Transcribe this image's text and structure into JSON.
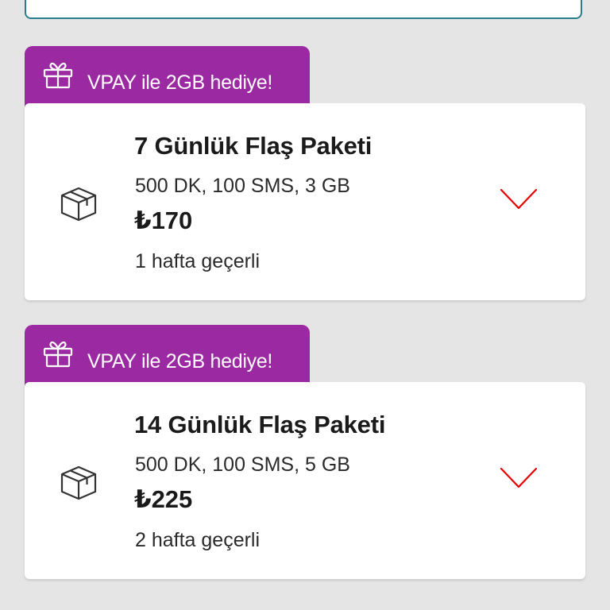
{
  "packages": [
    {
      "promo": "VPAY ile 2GB hediye!",
      "title": "7 Günlük Flaş Paketi",
      "details": "500 DK, 100 SMS, 3 GB",
      "price": "₺170",
      "validity": "1 hafta geçerli",
      "icons": {
        "promo": "gift-icon",
        "item": "box-icon",
        "expand": "chevron-down-icon"
      }
    },
    {
      "promo": "VPAY ile 2GB hediye!",
      "title": "14 Günlük Flaş Paketi",
      "details": "500 DK, 100 SMS, 5 GB",
      "price": "₺225",
      "validity": "2 hafta geçerli",
      "icons": {
        "promo": "gift-icon",
        "item": "box-icon",
        "expand": "chevron-down-icon"
      }
    }
  ],
  "colors": {
    "promo_bg": "#9b2aa2",
    "chevron": "#e60000",
    "top_card_border": "#2a7d8c",
    "background": "#e5e5e5"
  }
}
